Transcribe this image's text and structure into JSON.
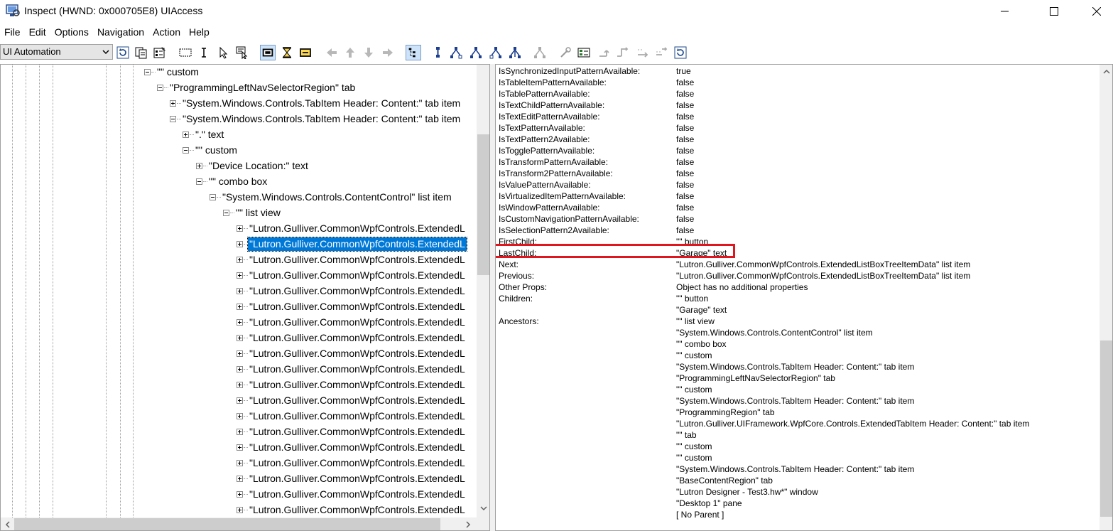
{
  "window": {
    "title": "Inspect  (HWND: 0x000705E8) UIAccess"
  },
  "menu": [
    "File",
    "Edit",
    "Options",
    "Navigation",
    "Action",
    "Help"
  ],
  "toolbar": {
    "mode": "UI Automation"
  },
  "tree": {
    "rows": [
      {
        "text": "\"\" custom",
        "indent": 202,
        "expander": "minus"
      },
      {
        "text": "\"ProgrammingLeftNavSelectorRegion\" tab",
        "indent": 220,
        "expander": "minus"
      },
      {
        "text": "\"System.Windows.Controls.TabItem Header: Content:\" tab item",
        "indent": 238,
        "expander": "plus"
      },
      {
        "text": "\"System.Windows.Controls.TabItem Header: Content:\" tab item",
        "indent": 238,
        "expander": "minus"
      },
      {
        "text": "\".\" text",
        "indent": 256,
        "expander": "plus"
      },
      {
        "text": "\"\" custom",
        "indent": 256,
        "expander": "minus"
      },
      {
        "text": "\"Device Location:\" text",
        "indent": 275,
        "expander": "plus"
      },
      {
        "text": "\"\" combo box",
        "indent": 275,
        "expander": "minus"
      },
      {
        "text": "\"System.Windows.Controls.ContentControl\" list item",
        "indent": 294,
        "expander": "minus"
      },
      {
        "text": "\"\" list view",
        "indent": 313,
        "expander": "minus"
      },
      {
        "text": "\"Lutron.Gulliver.CommonWpfControls.ExtendedL",
        "indent": 332,
        "expander": "plus"
      },
      {
        "text": "\"Lutron.Gulliver.CommonWpfControls.ExtendedL",
        "indent": 332,
        "expander": "plus",
        "selected": true
      },
      {
        "text": "\"Lutron.Gulliver.CommonWpfControls.ExtendedL",
        "indent": 332,
        "expander": "plus"
      },
      {
        "text": "\"Lutron.Gulliver.CommonWpfControls.ExtendedL",
        "indent": 332,
        "expander": "plus"
      },
      {
        "text": "\"Lutron.Gulliver.CommonWpfControls.ExtendedL",
        "indent": 332,
        "expander": "plus"
      },
      {
        "text": "\"Lutron.Gulliver.CommonWpfControls.ExtendedL",
        "indent": 332,
        "expander": "plus"
      },
      {
        "text": "\"Lutron.Gulliver.CommonWpfControls.ExtendedL",
        "indent": 332,
        "expander": "plus"
      },
      {
        "text": "\"Lutron.Gulliver.CommonWpfControls.ExtendedL",
        "indent": 332,
        "expander": "plus"
      },
      {
        "text": "\"Lutron.Gulliver.CommonWpfControls.ExtendedL",
        "indent": 332,
        "expander": "plus"
      },
      {
        "text": "\"Lutron.Gulliver.CommonWpfControls.ExtendedL",
        "indent": 332,
        "expander": "plus"
      },
      {
        "text": "\"Lutron.Gulliver.CommonWpfControls.ExtendedL",
        "indent": 332,
        "expander": "plus"
      },
      {
        "text": "\"Lutron.Gulliver.CommonWpfControls.ExtendedL",
        "indent": 332,
        "expander": "plus"
      },
      {
        "text": "\"Lutron.Gulliver.CommonWpfControls.ExtendedL",
        "indent": 332,
        "expander": "plus"
      },
      {
        "text": "\"Lutron.Gulliver.CommonWpfControls.ExtendedL",
        "indent": 332,
        "expander": "plus"
      },
      {
        "text": "\"Lutron.Gulliver.CommonWpfControls.ExtendedL",
        "indent": 332,
        "expander": "plus"
      },
      {
        "text": "\"Lutron.Gulliver.CommonWpfControls.ExtendedL",
        "indent": 332,
        "expander": "plus"
      },
      {
        "text": "\"Lutron.Gulliver.CommonWpfControls.ExtendedL",
        "indent": 332,
        "expander": "plus"
      },
      {
        "text": "\"Lutron.Gulliver.CommonWpfControls.ExtendedL",
        "indent": 332,
        "expander": "plus"
      },
      {
        "text": "\"Lutron.Gulliver.CommonWpfControls.ExtendedL",
        "indent": 332,
        "expander": "plus"
      }
    ]
  },
  "properties": [
    {
      "name": "IsSynchronizedInputPatternAvailable:",
      "value": "true"
    },
    {
      "name": "IsTableItemPatternAvailable:",
      "value": "false"
    },
    {
      "name": "IsTablePatternAvailable:",
      "value": "false"
    },
    {
      "name": "IsTextChildPatternAvailable:",
      "value": "false"
    },
    {
      "name": "IsTextEditPatternAvailable:",
      "value": "false"
    },
    {
      "name": "IsTextPatternAvailable:",
      "value": "false"
    },
    {
      "name": "IsTextPattern2Available:",
      "value": "false"
    },
    {
      "name": "IsTogglePatternAvailable:",
      "value": "false"
    },
    {
      "name": "IsTransformPatternAvailable:",
      "value": "false"
    },
    {
      "name": "IsTransform2PatternAvailable:",
      "value": "false"
    },
    {
      "name": "IsValuePatternAvailable:",
      "value": "false"
    },
    {
      "name": "IsVirtualizedItemPatternAvailable:",
      "value": "false"
    },
    {
      "name": "IsWindowPatternAvailable:",
      "value": "false"
    },
    {
      "name": "IsCustomNavigationPatternAvailable:",
      "value": "false"
    },
    {
      "name": "IsSelectionPattern2Available:",
      "value": "false"
    },
    {
      "name": "FirstChild:",
      "value": "\"\" button"
    },
    {
      "name": "LastChild:",
      "value": "\"Garage\" text"
    },
    {
      "name": "Next:",
      "value": "\"Lutron.Gulliver.CommonWpfControls.ExtendedListBoxTreeItemData\" list item"
    },
    {
      "name": "Previous:",
      "value": "\"Lutron.Gulliver.CommonWpfControls.ExtendedListBoxTreeItemData\" list item"
    },
    {
      "name": "Other Props:",
      "value": "Object has no additional properties"
    },
    {
      "name": "Children:",
      "value": "\"\" button"
    },
    {
      "name": "",
      "value": "\"Garage\" text"
    },
    {
      "name": "Ancestors:",
      "value": "\"\" list view"
    },
    {
      "name": "",
      "value": "\"System.Windows.Controls.ContentControl\" list item"
    },
    {
      "name": "",
      "value": "\"\" combo box"
    },
    {
      "name": "",
      "value": "\"\" custom"
    },
    {
      "name": "",
      "value": "\"System.Windows.Controls.TabItem Header: Content:\" tab item"
    },
    {
      "name": "",
      "value": "\"ProgrammingLeftNavSelectorRegion\" tab"
    },
    {
      "name": "",
      "value": "\"\" custom"
    },
    {
      "name": "",
      "value": "\"System.Windows.Controls.TabItem Header: Content:\" tab item"
    },
    {
      "name": "",
      "value": "\"ProgrammingRegion\" tab"
    },
    {
      "name": "",
      "value": "\"Lutron.Gulliver.UIFramework.WpfCore.Controls.ExtendedTabItem Header: Content:\" tab item"
    },
    {
      "name": "",
      "value": "\"\" tab"
    },
    {
      "name": "",
      "value": "\"\" custom"
    },
    {
      "name": "",
      "value": "\"\" custom"
    },
    {
      "name": "",
      "value": "\"System.Windows.Controls.TabItem Header: Content:\" tab item"
    },
    {
      "name": "",
      "value": "\"BaseContentRegion\" tab"
    },
    {
      "name": "",
      "value": "\"Lutron Designer - Test3.hw*\" window"
    },
    {
      "name": "",
      "value": "\"Desktop 1\" pane"
    },
    {
      "name": "",
      "value": "[ No Parent ]"
    }
  ],
  "colors": {
    "selection": "#0078d7",
    "highlight_border": "#e0161e"
  }
}
